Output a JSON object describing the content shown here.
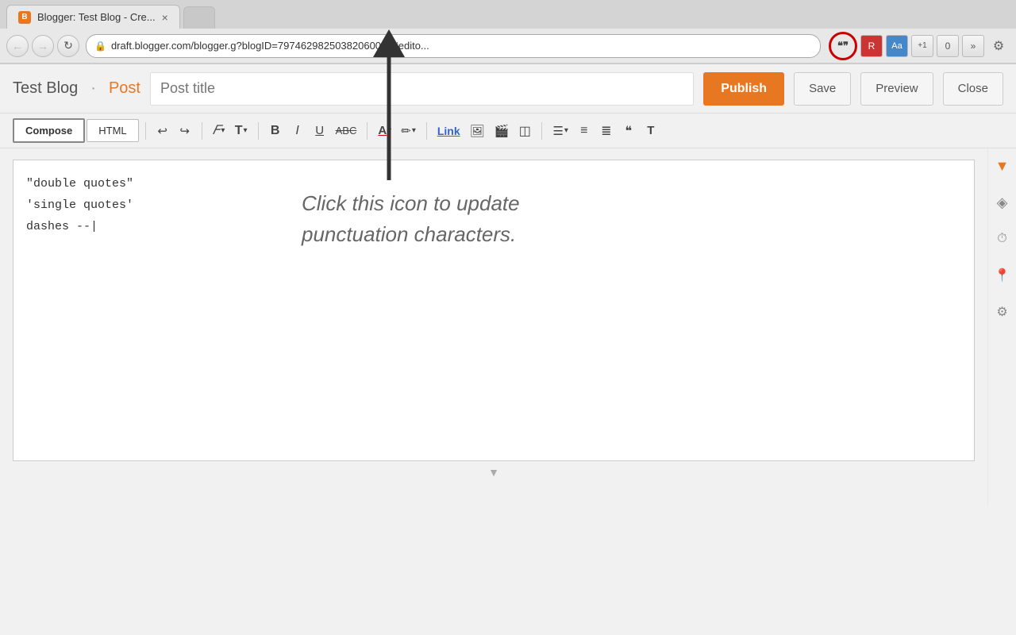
{
  "browser": {
    "tab_favicon": "B",
    "tab_title": "Blogger: Test Blog - Cre...",
    "tab_close": "×",
    "nav_back": "←",
    "nav_forward": "→",
    "nav_refresh": "↻",
    "address_url": "draft.blogger.com/blogger.g?blogID=79746298250382060099#edito...",
    "address_prefix": "draft.blogger.com",
    "quotes_icon_label": "❝❞",
    "ext_R": "R",
    "ext_Aa": "Aa",
    "ext_plus1": "+1",
    "ext_count": "0",
    "ext_more": "»",
    "wrench": "⚙"
  },
  "editor": {
    "blog_name": "Test Blog",
    "separator": "·",
    "post_label": "Post",
    "post_title_placeholder": "Post title",
    "btn_publish": "Publish",
    "btn_save": "Save",
    "btn_preview": "Preview",
    "btn_close": "Close"
  },
  "toolbar": {
    "compose_label": "Compose",
    "html_label": "HTML",
    "undo": "↩",
    "redo": "↪",
    "font_family": "𝐹",
    "font_size": "T",
    "bold": "B",
    "italic": "I",
    "underline": "U",
    "strikethrough": "ABC",
    "text_color": "A",
    "highlight": "✏",
    "link": "Link",
    "image": "🖼",
    "video": "🎬",
    "special": "◫",
    "align": "≡",
    "numbered": "≡",
    "bullets": "≡",
    "blockquote": "❝",
    "remove_format": "T"
  },
  "content": {
    "line1": "\"double quotes\"",
    "line2": "'single quotes'",
    "line3": "dashes --|"
  },
  "annotation": {
    "text_line1": "Click this icon to update",
    "text_line2": "punctuation characters."
  },
  "right_panel": {
    "icon1": "▼",
    "icon2": "◈",
    "icon3": "⏱",
    "icon4": "📍",
    "icon5": "⚙"
  }
}
